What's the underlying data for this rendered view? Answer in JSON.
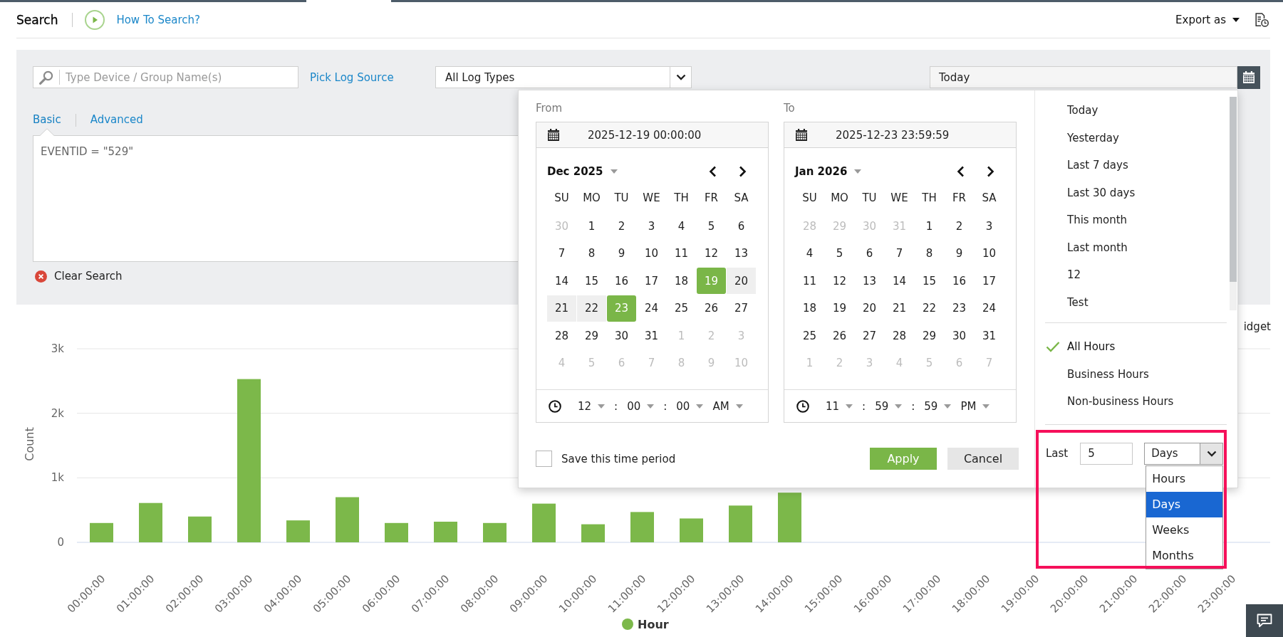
{
  "header": {
    "title": "Search",
    "help_link": "How To Search?",
    "export_label": "Export as"
  },
  "search_panel": {
    "device_field": {
      "placeholder": "Type Device / Group Name(s)"
    },
    "source_link": "Pick Log Source",
    "log_type": "All Log Types",
    "period": "Today",
    "query_tabs": [
      {
        "label": "Basic",
        "selected": true
      },
      {
        "label": "Advanced",
        "selected": false
      }
    ],
    "query": "EVENTID = \"529\"",
    "clear_label": "Clear Search"
  },
  "date_picker": {
    "ranges": [
      {
        "label": "From",
        "value": "2025-12-19 00:00:00",
        "month": "Dec 2025",
        "weekdays": [
          "SU",
          "MO",
          "TU",
          "WE",
          "TH",
          "FR",
          "SA"
        ],
        "days": [
          {
            "label": "30",
            "outside": true,
            "selected": false,
            "in_range": false
          },
          {
            "label": "1",
            "outside": false,
            "selected": false,
            "in_range": false
          },
          {
            "label": "2",
            "outside": false,
            "selected": false,
            "in_range": false
          },
          {
            "label": "3",
            "outside": false,
            "selected": false,
            "in_range": false
          },
          {
            "label": "4",
            "outside": false,
            "selected": false,
            "in_range": false
          },
          {
            "label": "5",
            "outside": false,
            "selected": false,
            "in_range": false
          },
          {
            "label": "6",
            "outside": false,
            "selected": false,
            "in_range": false
          },
          {
            "label": "7",
            "outside": false,
            "selected": false,
            "in_range": false
          },
          {
            "label": "8",
            "outside": false,
            "selected": false,
            "in_range": false
          },
          {
            "label": "9",
            "outside": false,
            "selected": false,
            "in_range": false
          },
          {
            "label": "10",
            "outside": false,
            "selected": false,
            "in_range": false
          },
          {
            "label": "11",
            "outside": false,
            "selected": false,
            "in_range": false
          },
          {
            "label": "12",
            "outside": false,
            "selected": false,
            "in_range": false
          },
          {
            "label": "13",
            "outside": false,
            "selected": false,
            "in_range": false
          },
          {
            "label": "14",
            "outside": false,
            "selected": false,
            "in_range": false
          },
          {
            "label": "15",
            "outside": false,
            "selected": false,
            "in_range": false
          },
          {
            "label": "16",
            "outside": false,
            "selected": false,
            "in_range": false
          },
          {
            "label": "17",
            "outside": false,
            "selected": false,
            "in_range": false
          },
          {
            "label": "18",
            "outside": false,
            "selected": false,
            "in_range": false
          },
          {
            "label": "19",
            "outside": false,
            "selected": true,
            "in_range": false
          },
          {
            "label": "20",
            "outside": false,
            "selected": false,
            "in_range": true
          },
          {
            "label": "21",
            "outside": false,
            "selected": false,
            "in_range": true
          },
          {
            "label": "22",
            "outside": false,
            "selected": false,
            "in_range": true
          },
          {
            "label": "23",
            "outside": false,
            "selected": true,
            "in_range": false
          },
          {
            "label": "24",
            "outside": false,
            "selected": false,
            "in_range": false
          },
          {
            "label": "25",
            "outside": false,
            "selected": false,
            "in_range": false
          },
          {
            "label": "26",
            "outside": false,
            "selected": false,
            "in_range": false
          },
          {
            "label": "27",
            "outside": false,
            "selected": false,
            "in_range": false
          },
          {
            "label": "28",
            "outside": false,
            "selected": false,
            "in_range": false
          },
          {
            "label": "29",
            "outside": false,
            "selected": false,
            "in_range": false
          },
          {
            "label": "30",
            "outside": false,
            "selected": false,
            "in_range": false
          },
          {
            "label": "31",
            "outside": false,
            "selected": false,
            "in_range": false
          },
          {
            "label": "1",
            "outside": true,
            "selected": false,
            "in_range": false
          },
          {
            "label": "2",
            "outside": true,
            "selected": false,
            "in_range": false
          },
          {
            "label": "3",
            "outside": true,
            "selected": false,
            "in_range": false
          },
          {
            "label": "4",
            "outside": true,
            "selected": false,
            "in_range": false
          },
          {
            "label": "5",
            "outside": true,
            "selected": false,
            "in_range": false
          },
          {
            "label": "6",
            "outside": true,
            "selected": false,
            "in_range": false
          },
          {
            "label": "7",
            "outside": true,
            "selected": false,
            "in_range": false
          },
          {
            "label": "8",
            "outside": true,
            "selected": false,
            "in_range": false
          },
          {
            "label": "9",
            "outside": true,
            "selected": false,
            "in_range": false
          },
          {
            "label": "10",
            "outside": true,
            "selected": false,
            "in_range": false
          }
        ],
        "time": [
          {
            "kind": "select",
            "label": "12"
          },
          {
            "kind": "separator",
            "label": ":"
          },
          {
            "kind": "select",
            "label": "00"
          },
          {
            "kind": "separator",
            "label": ":"
          },
          {
            "kind": "select",
            "label": "00"
          },
          {
            "kind": "select",
            "label": "AM"
          }
        ]
      },
      {
        "label": "To",
        "value": "2025-12-23 23:59:59",
        "month": "Jan 2026",
        "weekdays": [
          "SU",
          "MO",
          "TU",
          "WE",
          "TH",
          "FR",
          "SA"
        ],
        "days": [
          {
            "label": "28",
            "outside": true,
            "selected": false,
            "in_range": false
          },
          {
            "label": "29",
            "outside": true,
            "selected": false,
            "in_range": false
          },
          {
            "label": "30",
            "outside": true,
            "selected": false,
            "in_range": false
          },
          {
            "label": "31",
            "outside": true,
            "selected": false,
            "in_range": false
          },
          {
            "label": "1",
            "outside": false,
            "selected": false,
            "in_range": false
          },
          {
            "label": "2",
            "outside": false,
            "selected": false,
            "in_range": false
          },
          {
            "label": "3",
            "outside": false,
            "selected": false,
            "in_range": false
          },
          {
            "label": "4",
            "outside": false,
            "selected": false,
            "in_range": false
          },
          {
            "label": "5",
            "outside": false,
            "selected": false,
            "in_range": false
          },
          {
            "label": "6",
            "outside": false,
            "selected": false,
            "in_range": false
          },
          {
            "label": "7",
            "outside": false,
            "selected": false,
            "in_range": false
          },
          {
            "label": "8",
            "outside": false,
            "selected": false,
            "in_range": false
          },
          {
            "label": "9",
            "outside": false,
            "selected": false,
            "in_range": false
          },
          {
            "label": "10",
            "outside": false,
            "selected": false,
            "in_range": false
          },
          {
            "label": "11",
            "outside": false,
            "selected": false,
            "in_range": false
          },
          {
            "label": "12",
            "outside": false,
            "selected": false,
            "in_range": false
          },
          {
            "label": "13",
            "outside": false,
            "selected": false,
            "in_range": false
          },
          {
            "label": "14",
            "outside": false,
            "selected": false,
            "in_range": false
          },
          {
            "label": "15",
            "outside": false,
            "selected": false,
            "in_range": false
          },
          {
            "label": "16",
            "outside": false,
            "selected": false,
            "in_range": false
          },
          {
            "label": "17",
            "outside": false,
            "selected": false,
            "in_range": false
          },
          {
            "label": "18",
            "outside": false,
            "selected": false,
            "in_range": false
          },
          {
            "label": "19",
            "outside": false,
            "selected": false,
            "in_range": false
          },
          {
            "label": "20",
            "outside": false,
            "selected": false,
            "in_range": false
          },
          {
            "label": "21",
            "outside": false,
            "selected": false,
            "in_range": false
          },
          {
            "label": "22",
            "outside": false,
            "selected": false,
            "in_range": false
          },
          {
            "label": "23",
            "outside": false,
            "selected": false,
            "in_range": false
          },
          {
            "label": "24",
            "outside": false,
            "selected": false,
            "in_range": false
          },
          {
            "label": "25",
            "outside": false,
            "selected": false,
            "in_range": false
          },
          {
            "label": "26",
            "outside": false,
            "selected": false,
            "in_range": false
          },
          {
            "label": "27",
            "outside": false,
            "selected": false,
            "in_range": false
          },
          {
            "label": "28",
            "outside": false,
            "selected": false,
            "in_range": false
          },
          {
            "label": "29",
            "outside": false,
            "selected": false,
            "in_range": false
          },
          {
            "label": "30",
            "outside": false,
            "selected": false,
            "in_range": false
          },
          {
            "label": "31",
            "outside": false,
            "selected": false,
            "in_range": false
          },
          {
            "label": "1",
            "outside": true,
            "selected": false,
            "in_range": false
          },
          {
            "label": "2",
            "outside": true,
            "selected": false,
            "in_range": false
          },
          {
            "label": "3",
            "outside": true,
            "selected": false,
            "in_range": false
          },
          {
            "label": "4",
            "outside": true,
            "selected": false,
            "in_range": false
          },
          {
            "label": "5",
            "outside": true,
            "selected": false,
            "in_range": false
          },
          {
            "label": "6",
            "outside": true,
            "selected": false,
            "in_range": false
          },
          {
            "label": "7",
            "outside": true,
            "selected": false,
            "in_range": false
          }
        ],
        "time": [
          {
            "kind": "select",
            "label": "11"
          },
          {
            "kind": "separator",
            "label": ":"
          },
          {
            "kind": "select",
            "label": "59"
          },
          {
            "kind": "separator",
            "label": ":"
          },
          {
            "kind": "select",
            "label": "59"
          },
          {
            "kind": "select",
            "label": "PM"
          }
        ]
      }
    ],
    "save_period": {
      "label": "Save this time period",
      "checked": false
    },
    "buttons": [
      {
        "label": "Apply",
        "kind": "primary"
      },
      {
        "label": "Cancel",
        "kind": "secondary"
      }
    ],
    "presets": [
      {
        "label": "Today",
        "selected": false
      },
      {
        "label": "Yesterday",
        "selected": false
      },
      {
        "label": "Last 7 days",
        "selected": false
      },
      {
        "label": "Last 30 days",
        "selected": false
      },
      {
        "label": "This month",
        "selected": false
      },
      {
        "label": "Last month",
        "selected": false
      },
      {
        "label": "12",
        "selected": false
      },
      {
        "label": "Test",
        "selected": false
      }
    ],
    "hours": [
      {
        "label": "All Hours",
        "selected": true
      },
      {
        "label": "Business Hours",
        "selected": false
      },
      {
        "label": "Non-business Hours",
        "selected": false
      }
    ],
    "last": {
      "label": "Last",
      "value": "5",
      "unit": "Days",
      "expanded": true,
      "options": [
        {
          "label": "Hours",
          "selected": false
        },
        {
          "label": "Days",
          "selected": true
        },
        {
          "label": "Weeks",
          "selected": false
        },
        {
          "label": "Months",
          "selected": false
        }
      ]
    }
  },
  "chart": {
    "side_label": "idget",
    "chart_data": {
      "type": "bar",
      "ylabel": "Count",
      "categories": [
        "00:00:00",
        "01:00:00",
        "02:00:00",
        "03:00:00",
        "04:00:00",
        "05:00:00",
        "06:00:00",
        "07:00:00",
        "08:00:00",
        "09:00:00",
        "10:00:00",
        "11:00:00",
        "12:00:00",
        "13:00:00",
        "14:00:00",
        "15:00:00",
        "16:00:00",
        "17:00:00",
        "18:00:00",
        "19:00:00",
        "20:00:00",
        "21:00:00",
        "22:00:00",
        "23:00:00"
      ],
      "series": [
        {
          "name": "Hour",
          "color": "#7cb84a",
          "values": [
            300,
            610,
            400,
            2530,
            340,
            700,
            300,
            320,
            300,
            600,
            280,
            470,
            370,
            570,
            770,
            0,
            0,
            0,
            0,
            0,
            0,
            0,
            0,
            0
          ]
        }
      ],
      "ylim": [
        0,
        3000
      ],
      "yticks": [
        {
          "value": 0,
          "label": "0"
        },
        {
          "value": 1000,
          "label": "1k"
        },
        {
          "value": 2000,
          "label": "2k"
        },
        {
          "value": 3000,
          "label": "3k"
        }
      ]
    }
  }
}
